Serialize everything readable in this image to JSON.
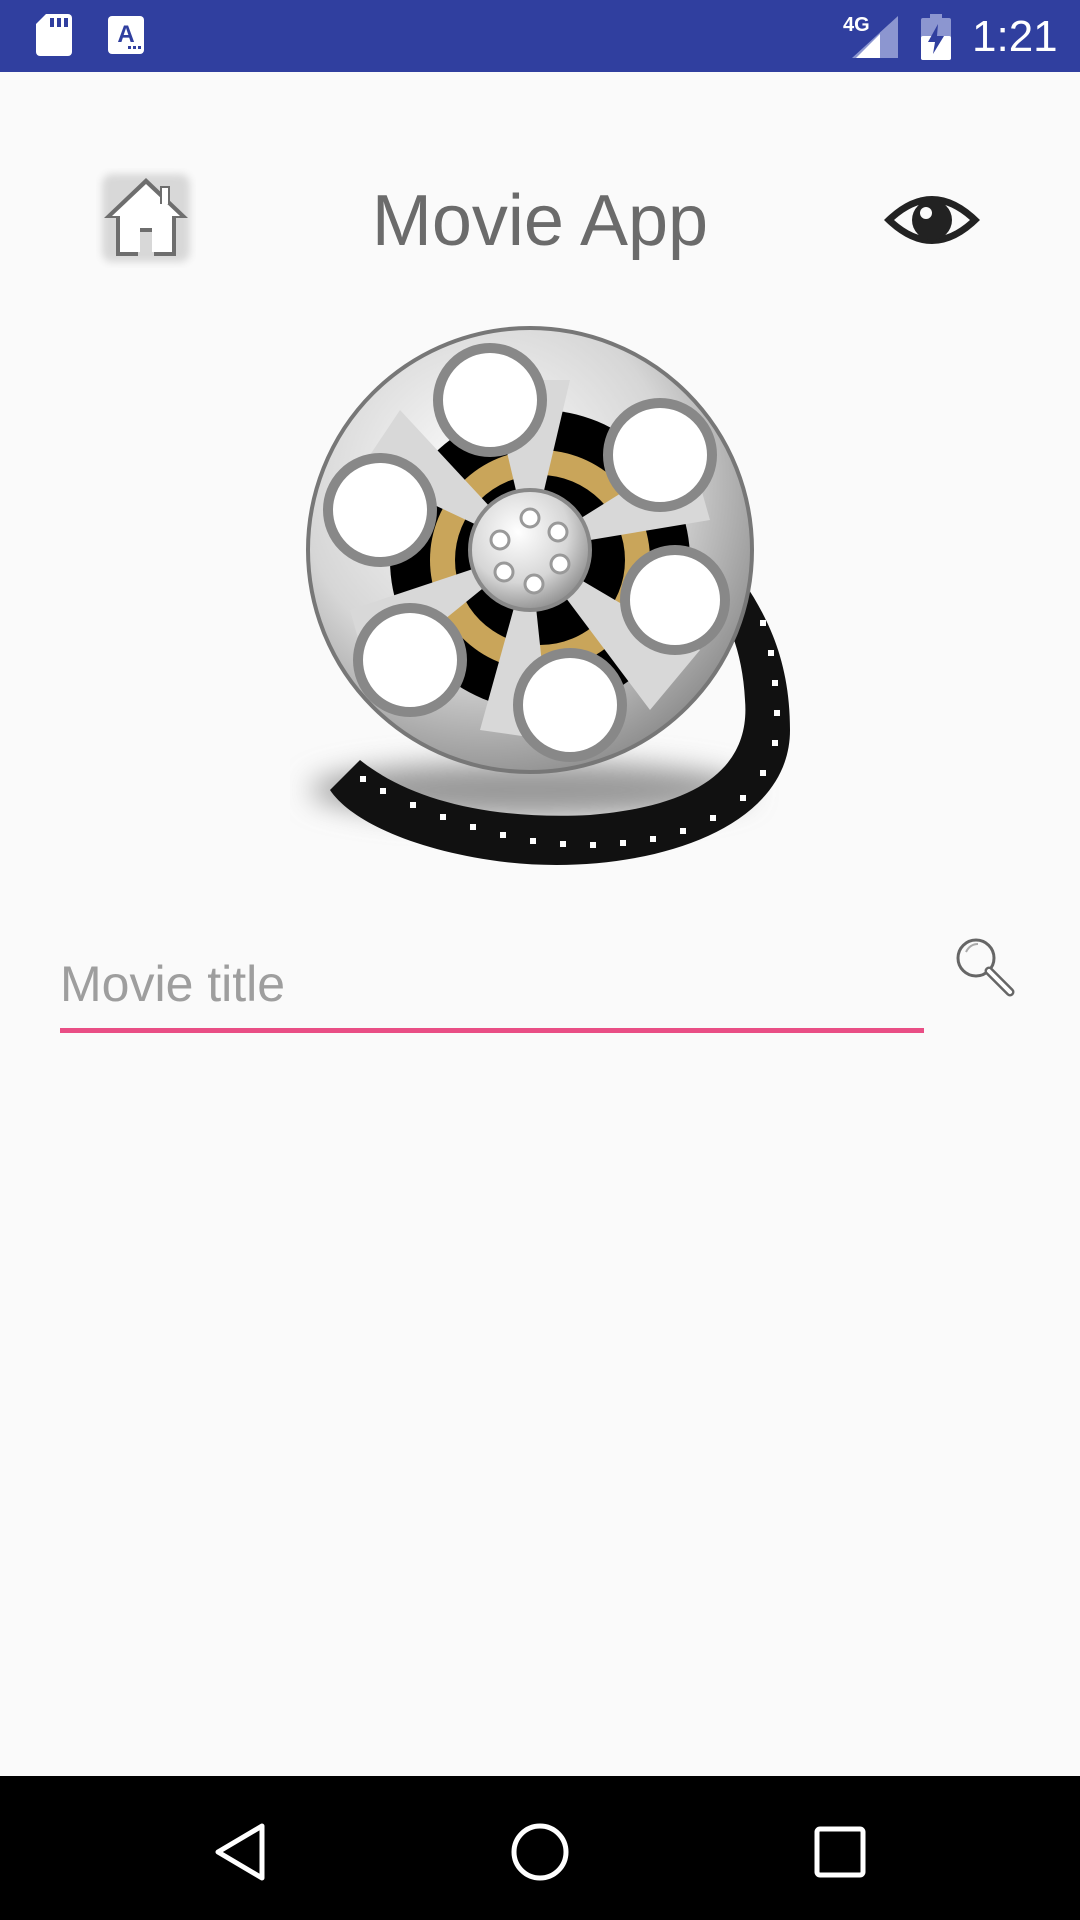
{
  "status_bar": {
    "network": "4G",
    "time": "1:21",
    "icons": [
      "sd-card-icon",
      "app-notification-icon",
      "signal-icon",
      "battery-charging-icon"
    ]
  },
  "header": {
    "title": "Movie App",
    "left_icon": "home-icon",
    "right_icon": "eye-icon"
  },
  "logo": {
    "icon": "film-reel-icon"
  },
  "search": {
    "value": "",
    "placeholder": "Movie title",
    "button_icon": "search-icon",
    "accent_color": "#e94e85"
  },
  "nav_bar": {
    "icons": [
      "back-icon",
      "home-circle-icon",
      "recents-icon"
    ]
  },
  "colors": {
    "status_bar": "#303f9f",
    "background": "#fafafa",
    "title_text": "#6b6b6b",
    "nav_bar": "#000000"
  }
}
